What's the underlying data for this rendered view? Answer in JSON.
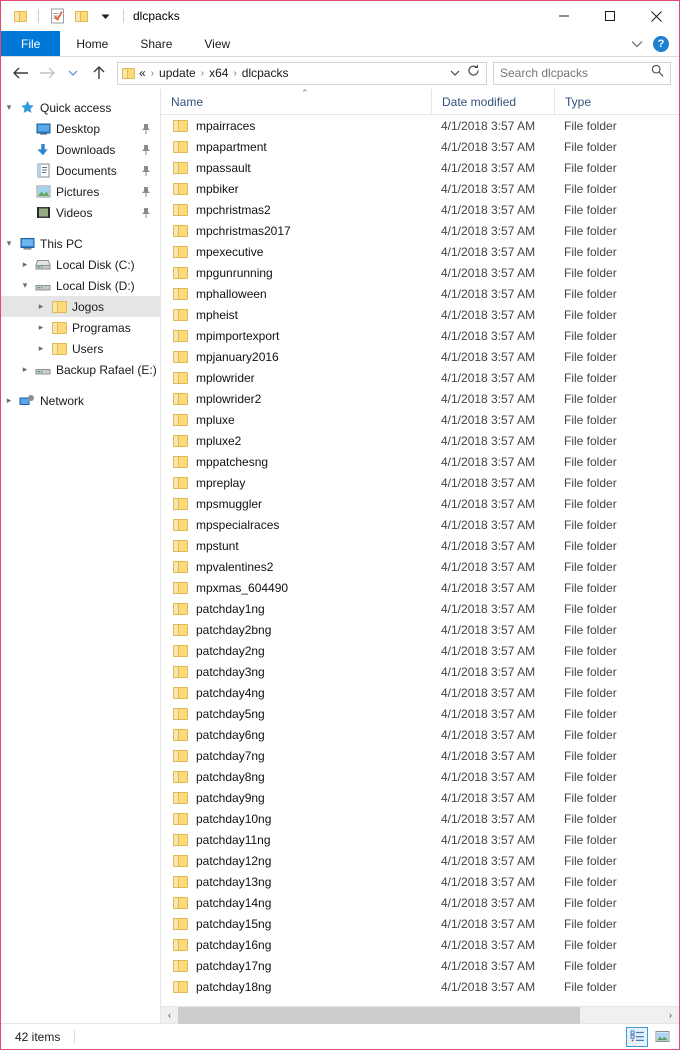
{
  "window": {
    "title": "dlcpacks",
    "accent_border": "#e04a6e",
    "quick_access_toolbar": [
      {
        "name": "folder-icon",
        "label": "Explorer"
      },
      {
        "name": "properties-icon",
        "label": "Properties"
      },
      {
        "name": "new-folder-icon",
        "label": "New folder"
      },
      {
        "name": "customize-qat-icon",
        "label": "Customize Quick Access Toolbar"
      }
    ],
    "controls": {
      "minimize": "Minimize",
      "maximize": "Maximize",
      "close": "Close"
    }
  },
  "ribbon": {
    "tabs": [
      {
        "label": "File",
        "active": true
      },
      {
        "label": "Home",
        "active": false
      },
      {
        "label": "Share",
        "active": false
      },
      {
        "label": "View",
        "active": false
      }
    ],
    "collapse_label": "Minimize the Ribbon",
    "help_label": "?",
    "file_tab_color": "#0078d7"
  },
  "address": {
    "back_label": "Back",
    "forward_label": "Forward",
    "recent_label": "Recent locations",
    "up_label": "Up",
    "overflow": "«",
    "crumbs": [
      "update",
      "x64",
      "dlcpacks"
    ],
    "crumb_separator": "›",
    "dropdown_label": "Previous locations",
    "refresh_label": "Refresh"
  },
  "search": {
    "placeholder": "Search dlcpacks",
    "icon": "search-icon"
  },
  "sidebar": {
    "groups": [
      {
        "name": "quick-access",
        "label": "Quick access",
        "icon": "star-icon",
        "expanded": true,
        "chevron": "⌄",
        "items": [
          {
            "label": "Desktop",
            "icon": "desktop-icon",
            "pinned": true
          },
          {
            "label": "Downloads",
            "icon": "downloads-icon",
            "pinned": true
          },
          {
            "label": "Documents",
            "icon": "documents-icon",
            "pinned": true
          },
          {
            "label": "Pictures",
            "icon": "pictures-icon",
            "pinned": true
          },
          {
            "label": "Videos",
            "icon": "videos-icon",
            "pinned": true
          }
        ]
      },
      {
        "name": "this-pc",
        "label": "This PC",
        "icon": "this-pc-icon",
        "expanded": true,
        "items": [
          {
            "label": "Local Disk (C:)",
            "icon": "drive-icon",
            "expanded": false,
            "indent": 1
          },
          {
            "label": "Local Disk (D:)",
            "icon": "drive-icon",
            "expanded": true,
            "indent": 1
          },
          {
            "label": "Jogos",
            "icon": "folder-icon",
            "expanded": false,
            "indent": 2,
            "selected": true
          },
          {
            "label": "Programas",
            "icon": "folder-icon",
            "expanded": false,
            "indent": 2
          },
          {
            "label": "Users",
            "icon": "folder-icon",
            "expanded": false,
            "indent": 2
          },
          {
            "label": "Backup Rafael (E:)",
            "icon": "drive-icon",
            "expanded": false,
            "indent": 1
          }
        ]
      },
      {
        "name": "network",
        "label": "Network",
        "icon": "network-icon",
        "expanded": false,
        "items": []
      }
    ]
  },
  "filelist": {
    "columns": [
      {
        "label": "Name",
        "sorted": "asc",
        "sort_glyph": "⌃"
      },
      {
        "label": "Date modified",
        "sorted": null
      },
      {
        "label": "Type",
        "sorted": null
      }
    ],
    "rows": [
      {
        "name": "mpairraces",
        "date": "4/1/2018 3:57 AM",
        "type": "File folder"
      },
      {
        "name": "mpapartment",
        "date": "4/1/2018 3:57 AM",
        "type": "File folder"
      },
      {
        "name": "mpassault",
        "date": "4/1/2018 3:57 AM",
        "type": "File folder"
      },
      {
        "name": "mpbiker",
        "date": "4/1/2018 3:57 AM",
        "type": "File folder"
      },
      {
        "name": "mpchristmas2",
        "date": "4/1/2018 3:57 AM",
        "type": "File folder"
      },
      {
        "name": "mpchristmas2017",
        "date": "4/1/2018 3:57 AM",
        "type": "File folder"
      },
      {
        "name": "mpexecutive",
        "date": "4/1/2018 3:57 AM",
        "type": "File folder"
      },
      {
        "name": "mpgunrunning",
        "date": "4/1/2018 3:57 AM",
        "type": "File folder"
      },
      {
        "name": "mphalloween",
        "date": "4/1/2018 3:57 AM",
        "type": "File folder"
      },
      {
        "name": "mpheist",
        "date": "4/1/2018 3:57 AM",
        "type": "File folder"
      },
      {
        "name": "mpimportexport",
        "date": "4/1/2018 3:57 AM",
        "type": "File folder"
      },
      {
        "name": "mpjanuary2016",
        "date": "4/1/2018 3:57 AM",
        "type": "File folder"
      },
      {
        "name": "mplowrider",
        "date": "4/1/2018 3:57 AM",
        "type": "File folder"
      },
      {
        "name": "mplowrider2",
        "date": "4/1/2018 3:57 AM",
        "type": "File folder"
      },
      {
        "name": "mpluxe",
        "date": "4/1/2018 3:57 AM",
        "type": "File folder"
      },
      {
        "name": "mpluxe2",
        "date": "4/1/2018 3:57 AM",
        "type": "File folder"
      },
      {
        "name": "mppatchesng",
        "date": "4/1/2018 3:57 AM",
        "type": "File folder"
      },
      {
        "name": "mpreplay",
        "date": "4/1/2018 3:57 AM",
        "type": "File folder"
      },
      {
        "name": "mpsmuggler",
        "date": "4/1/2018 3:57 AM",
        "type": "File folder"
      },
      {
        "name": "mpspecialraces",
        "date": "4/1/2018 3:57 AM",
        "type": "File folder"
      },
      {
        "name": "mpstunt",
        "date": "4/1/2018 3:57 AM",
        "type": "File folder"
      },
      {
        "name": "mpvalentines2",
        "date": "4/1/2018 3:57 AM",
        "type": "File folder"
      },
      {
        "name": "mpxmas_604490",
        "date": "4/1/2018 3:57 AM",
        "type": "File folder"
      },
      {
        "name": "patchday1ng",
        "date": "4/1/2018 3:57 AM",
        "type": "File folder"
      },
      {
        "name": "patchday2bng",
        "date": "4/1/2018 3:57 AM",
        "type": "File folder"
      },
      {
        "name": "patchday2ng",
        "date": "4/1/2018 3:57 AM",
        "type": "File folder"
      },
      {
        "name": "patchday3ng",
        "date": "4/1/2018 3:57 AM",
        "type": "File folder"
      },
      {
        "name": "patchday4ng",
        "date": "4/1/2018 3:57 AM",
        "type": "File folder"
      },
      {
        "name": "patchday5ng",
        "date": "4/1/2018 3:57 AM",
        "type": "File folder"
      },
      {
        "name": "patchday6ng",
        "date": "4/1/2018 3:57 AM",
        "type": "File folder"
      },
      {
        "name": "patchday7ng",
        "date": "4/1/2018 3:57 AM",
        "type": "File folder"
      },
      {
        "name": "patchday8ng",
        "date": "4/1/2018 3:57 AM",
        "type": "File folder"
      },
      {
        "name": "patchday9ng",
        "date": "4/1/2018 3:57 AM",
        "type": "File folder"
      },
      {
        "name": "patchday10ng",
        "date": "4/1/2018 3:57 AM",
        "type": "File folder"
      },
      {
        "name": "patchday11ng",
        "date": "4/1/2018 3:57 AM",
        "type": "File folder"
      },
      {
        "name": "patchday12ng",
        "date": "4/1/2018 3:57 AM",
        "type": "File folder"
      },
      {
        "name": "patchday13ng",
        "date": "4/1/2018 3:57 AM",
        "type": "File folder"
      },
      {
        "name": "patchday14ng",
        "date": "4/1/2018 3:57 AM",
        "type": "File folder"
      },
      {
        "name": "patchday15ng",
        "date": "4/1/2018 3:57 AM",
        "type": "File folder"
      },
      {
        "name": "patchday16ng",
        "date": "4/1/2018 3:57 AM",
        "type": "File folder"
      },
      {
        "name": "patchday17ng",
        "date": "4/1/2018 3:57 AM",
        "type": "File folder"
      },
      {
        "name": "patchday18ng",
        "date": "4/1/2018 3:57 AM",
        "type": "File folder"
      }
    ]
  },
  "scrollbar": {
    "left_arrow": "‹",
    "right_arrow": "›"
  },
  "statusbar": {
    "item_count": "42 items",
    "views": [
      {
        "name": "details-view-button",
        "label": "Details",
        "active": true
      },
      {
        "name": "large-icons-view-button",
        "label": "Large icons",
        "active": false
      }
    ]
  }
}
